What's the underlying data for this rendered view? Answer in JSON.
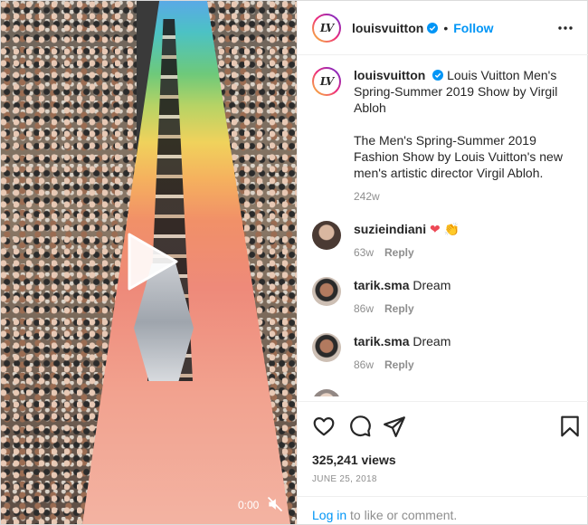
{
  "header": {
    "username": "louisvuitton",
    "separator": "•",
    "follow_label": "Follow",
    "avatar_monogram": "LV"
  },
  "caption": {
    "username": "louisvuitton",
    "title": "Louis Vuitton Men's Spring-Summer 2019 Show by Virgil Abloh",
    "body": "The Men's Spring-Summer 2019 Fashion Show by Louis Vuitton's new men's artistic director Virgil Abloh.",
    "age": "242w"
  },
  "comments": [
    {
      "username": "suzieindiani",
      "text": "",
      "emojis": [
        "❤",
        "👏"
      ],
      "age": "63w",
      "reply_label": "Reply"
    },
    {
      "username": "tarik.sma",
      "text": "Dream",
      "emojis": [],
      "age": "86w",
      "reply_label": "Reply"
    },
    {
      "username": "tarik.sma",
      "text": "Dream",
      "emojis": [],
      "age": "86w",
      "reply_label": "Reply"
    }
  ],
  "video": {
    "time": "0:00",
    "icons": [
      "play-icon",
      "mute-icon"
    ]
  },
  "actions": {
    "icons": [
      "like-icon",
      "comment-icon",
      "share-icon",
      "save-icon"
    ],
    "views": "325,241 views",
    "date": "JUNE 25, 2018"
  },
  "login": {
    "link": "Log in",
    "text": " to like or comment."
  },
  "colors": {
    "accent": "#0095f6",
    "muted": "#8e8e8e",
    "heart": "#ed4956"
  }
}
